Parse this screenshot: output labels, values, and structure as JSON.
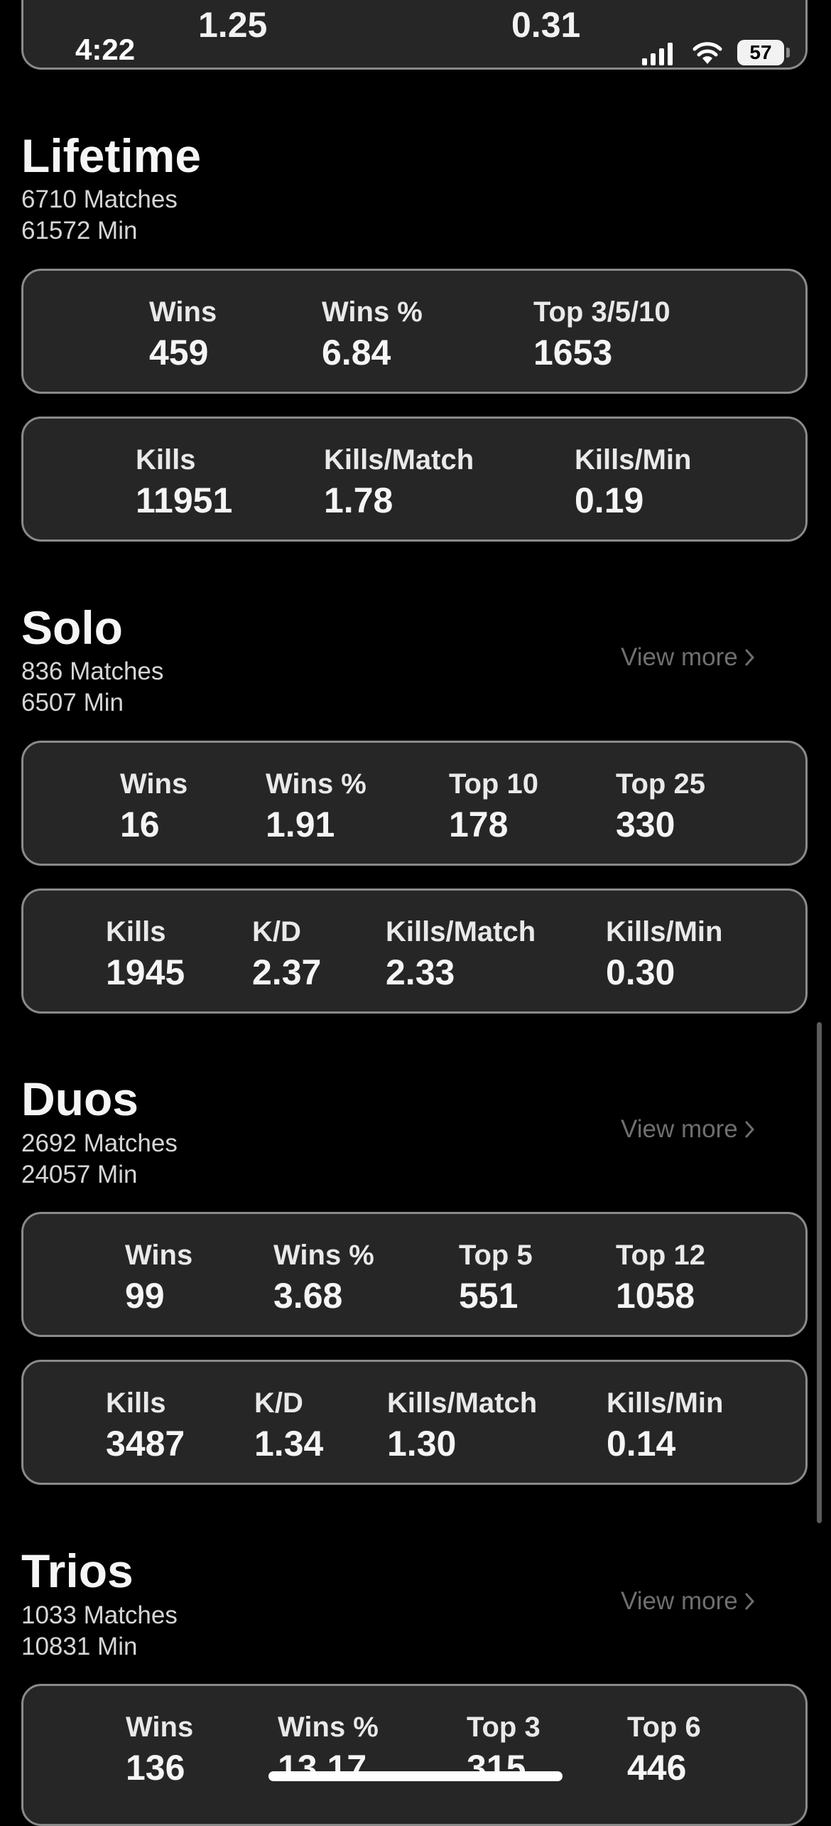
{
  "status": {
    "time": "4:22",
    "battery": "57"
  },
  "top_partial": {
    "left_value": "1.25",
    "right_value": "0.31"
  },
  "lifetime": {
    "title": "Lifetime",
    "matches": "6710 Matches",
    "minutes": "61572 Min",
    "row1": [
      {
        "label": "Wins",
        "value": "459"
      },
      {
        "label": "Wins %",
        "value": "6.84"
      },
      {
        "label": "Top 3/5/10",
        "value": "1653"
      }
    ],
    "row2": [
      {
        "label": "Kills",
        "value": "11951"
      },
      {
        "label": "Kills/Match",
        "value": "1.78"
      },
      {
        "label": "Kills/Min",
        "value": "0.19"
      }
    ]
  },
  "solo": {
    "title": "Solo",
    "matches": "836 Matches",
    "minutes": "6507 Min",
    "view_more": "View more",
    "row1": [
      {
        "label": "Wins",
        "value": "16"
      },
      {
        "label": "Wins %",
        "value": "1.91"
      },
      {
        "label": "Top 10",
        "value": "178"
      },
      {
        "label": "Top 25",
        "value": "330"
      }
    ],
    "row2": [
      {
        "label": "Kills",
        "value": "1945"
      },
      {
        "label": "K/D",
        "value": "2.37"
      },
      {
        "label": "Kills/Match",
        "value": "2.33"
      },
      {
        "label": "Kills/Min",
        "value": "0.30"
      }
    ]
  },
  "duos": {
    "title": "Duos",
    "matches": "2692 Matches",
    "minutes": "24057 Min",
    "view_more": "View more",
    "row1": [
      {
        "label": "Wins",
        "value": "99"
      },
      {
        "label": "Wins %",
        "value": "3.68"
      },
      {
        "label": "Top 5",
        "value": "551"
      },
      {
        "label": "Top 12",
        "value": "1058"
      }
    ],
    "row2": [
      {
        "label": "Kills",
        "value": "3487"
      },
      {
        "label": "K/D",
        "value": "1.34"
      },
      {
        "label": "Kills/Match",
        "value": "1.30"
      },
      {
        "label": "Kills/Min",
        "value": "0.14"
      }
    ]
  },
  "trios": {
    "title": "Trios",
    "matches": "1033 Matches",
    "minutes": "10831 Min",
    "view_more": "View more",
    "row1": [
      {
        "label": "Wins",
        "value": "136"
      },
      {
        "label": "Wins %",
        "value": "13.17"
      },
      {
        "label": "Top 3",
        "value": "315"
      },
      {
        "label": "Top 6",
        "value": "446"
      }
    ]
  }
}
